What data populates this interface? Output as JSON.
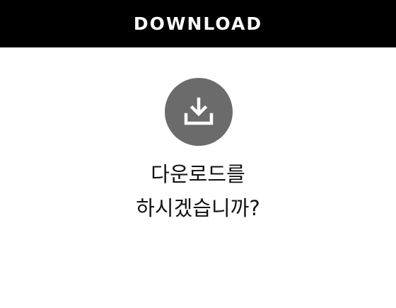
{
  "dialog": {
    "title": "DOWNLOAD",
    "icon": "download-icon",
    "message_line1": "다운로드를",
    "message_line2": "하시겠습니까?"
  },
  "colors": {
    "header_bg": "#000000",
    "header_text": "#ffffff",
    "icon_circle": "#6b6b6b",
    "message_text": "#111111"
  }
}
